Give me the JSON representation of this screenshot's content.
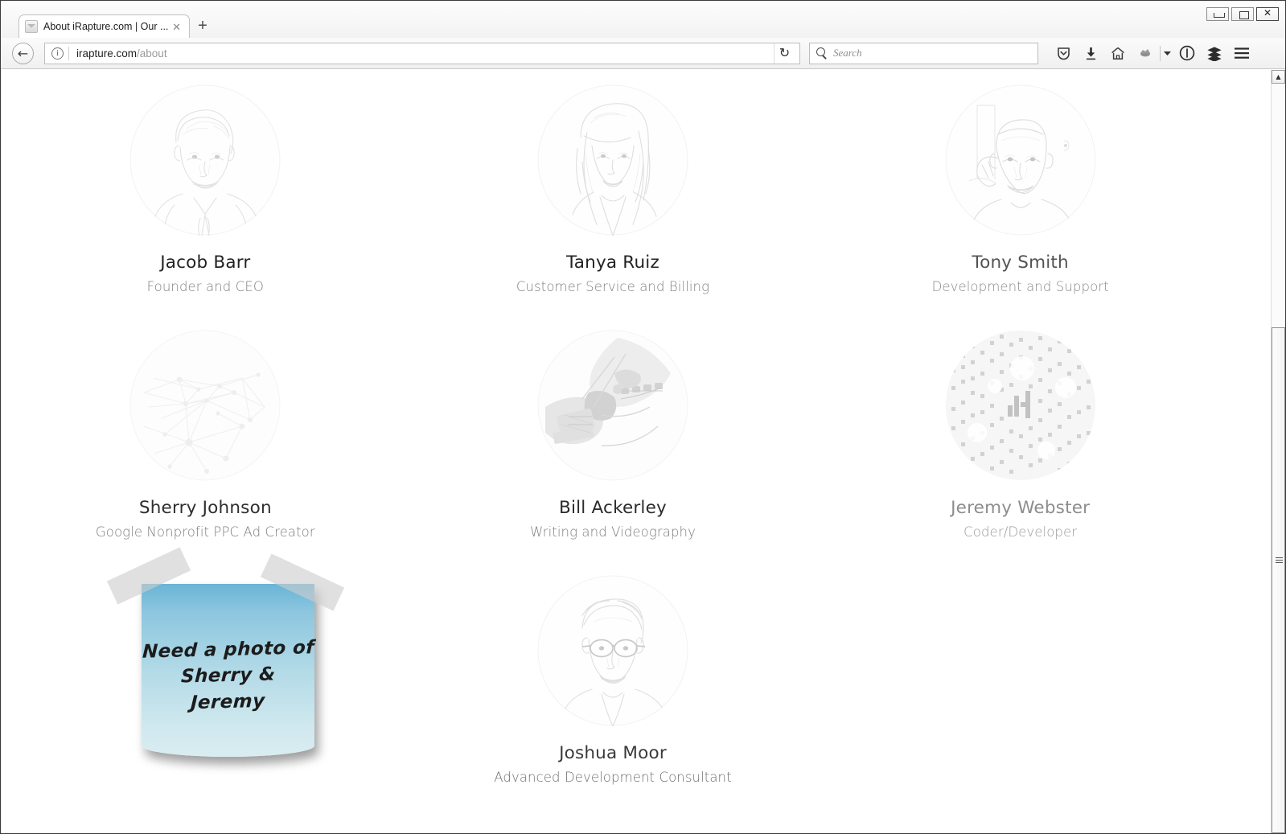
{
  "browser": {
    "tab": {
      "title": "About iRapture.com | Our ...",
      "favicon_name": "site-favicon",
      "close_label": "✕"
    },
    "newtab_label": "+",
    "window_controls": {
      "minimize": "minimize",
      "restore": "restore",
      "close": "close"
    },
    "back_label": "←",
    "url": {
      "domain": "irapture.com",
      "path": "/about",
      "identity_icon": "info-icon"
    },
    "reload_label": "↻",
    "search": {
      "placeholder": "Search",
      "icon": "search-icon"
    },
    "toolbar_icons": [
      "pocket-icon",
      "downloads-icon",
      "home-icon",
      "addon-icon",
      "dropdown-caret-icon",
      "page-action-icon",
      "library-icon",
      "menu-hamburger-icon"
    ]
  },
  "page": {
    "team": [
      {
        "name": "Jacob Barr",
        "role": "Founder and CEO",
        "avatar": "portrait-sketch-man-tie",
        "name_color": "#232323",
        "role_color": "#808080"
      },
      {
        "name": "Tanya Ruiz",
        "role": "Customer Service and Billing",
        "avatar": "portrait-sketch-woman",
        "name_color": "#232323",
        "role_color": "#808080"
      },
      {
        "name": "Tony Smith",
        "role": "Development and Support",
        "avatar": "portrait-sketch-man-bald",
        "name_color": "#535353",
        "role_color": "#8a8a8a"
      },
      {
        "name": "Sherry Johnson",
        "role": "Google Nonprofit PPC Ad Creator",
        "avatar": "abstract-network-graphic",
        "name_color": "#2e2e2e",
        "role_color": "#7d7d7d"
      },
      {
        "name": "Bill Ackerley",
        "role": "Writing and Videography",
        "avatar": "camera-equipment-photo",
        "name_color": "#2b2b2b",
        "role_color": "#7d7d7d"
      },
      {
        "name": "Jeremy Webster",
        "role": "Coder/Developer",
        "avatar": "digital-rain-matrix-graphic",
        "name_color": "#8d8d8d",
        "role_color": "#9a9a9a"
      },
      {
        "name": "Joshua Moor",
        "role": "Advanced Development Consultant",
        "avatar": "portrait-sketch-man-glasses",
        "name_color": "#3a3a3a",
        "role_color": "#6f6f6f"
      }
    ],
    "sticky_note": {
      "lines": [
        "Need a photo of",
        "Sherry &",
        "Jeremy"
      ],
      "color_top": "#6ab4d6",
      "color_bottom": "#d9edf1",
      "tape_color": "#cdcdcd"
    }
  }
}
